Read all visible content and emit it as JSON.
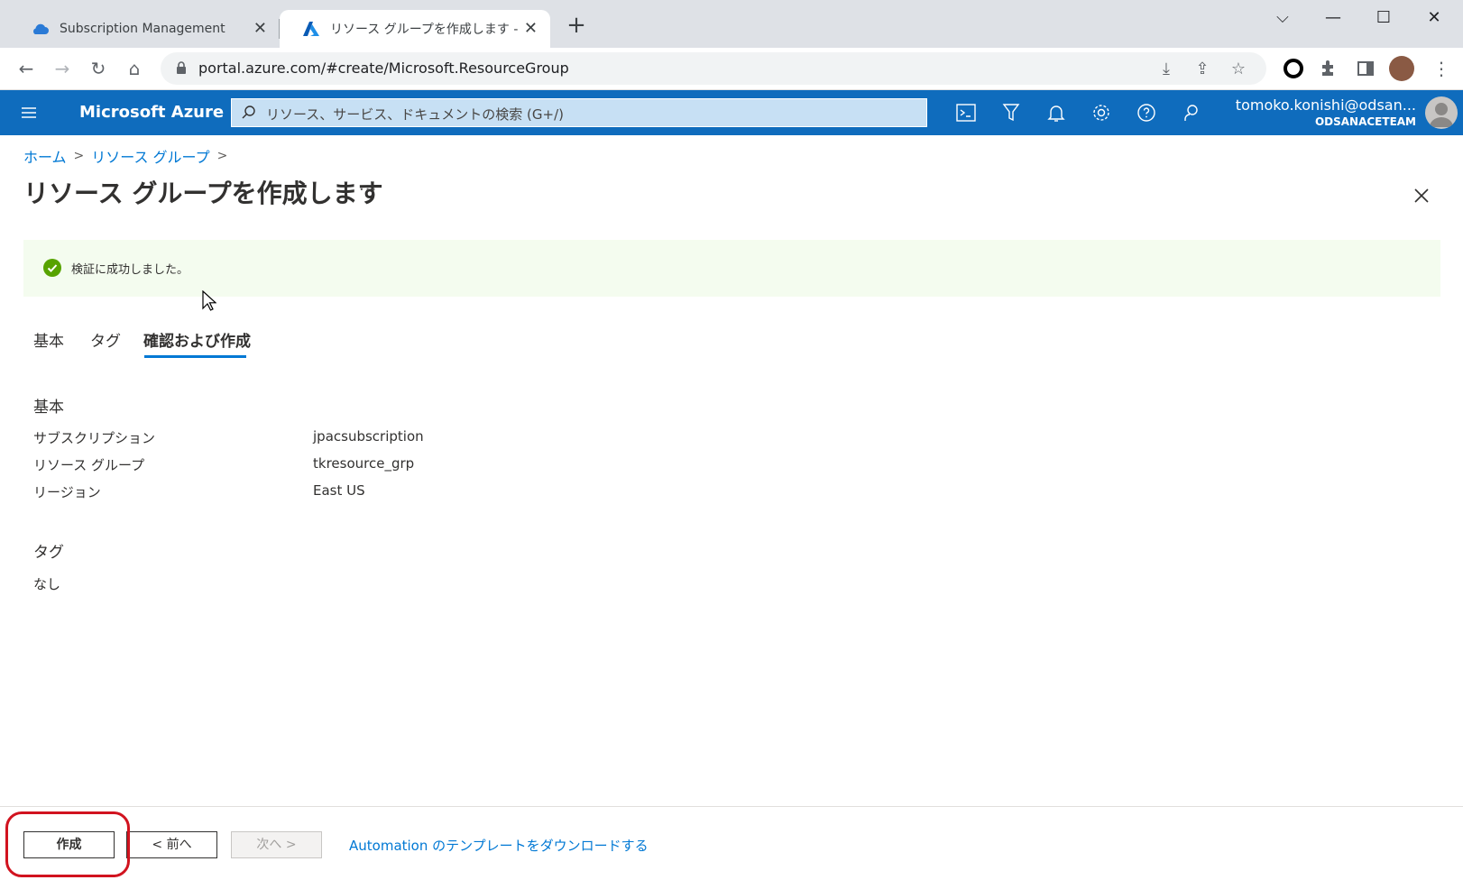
{
  "browser": {
    "tabs": [
      {
        "label": "Subscription Management",
        "icon": "cloud-icon",
        "active": false
      },
      {
        "label": "リソース グループを作成します - Micro",
        "icon": "azure-logo-icon",
        "active": true
      }
    ],
    "url": "portal.azure.com/#create/Microsoft.ResourceGroup"
  },
  "azure_header": {
    "brand": "Microsoft Azure",
    "search_placeholder": "リソース、サービス、ドキュメントの検索 (G+/)",
    "account_name": "tomoko.konishi@odsan...",
    "account_org": "ODSANACETEAM"
  },
  "breadcrumb": {
    "home": "ホーム",
    "resource_groups": "リソース グループ",
    "sep": ">"
  },
  "page": {
    "title": "リソース グループを作成します",
    "more": "···"
  },
  "banner": {
    "message": "検証に成功しました。",
    "status_color": "#57a300"
  },
  "tabs": [
    "基本",
    "タグ",
    "確認および作成"
  ],
  "basics": {
    "section_title": "基本",
    "rows": [
      {
        "label": "サブスクリプション",
        "value": "jpacsubscription"
      },
      {
        "label": "リソース グループ",
        "value": "tkresource_grp"
      },
      {
        "label": "リージョン",
        "value": "East US"
      }
    ]
  },
  "tags": {
    "section_title": "タグ",
    "value": "なし"
  },
  "footer": {
    "create": "作成",
    "prev": "< 前へ",
    "next": "次へ >",
    "automation_link": "Automation のテンプレートをダウンロードする"
  },
  "colors": {
    "azure_blue": "#0f6cbd",
    "link_blue": "#0078d4",
    "highlight_red": "#d1131f"
  }
}
